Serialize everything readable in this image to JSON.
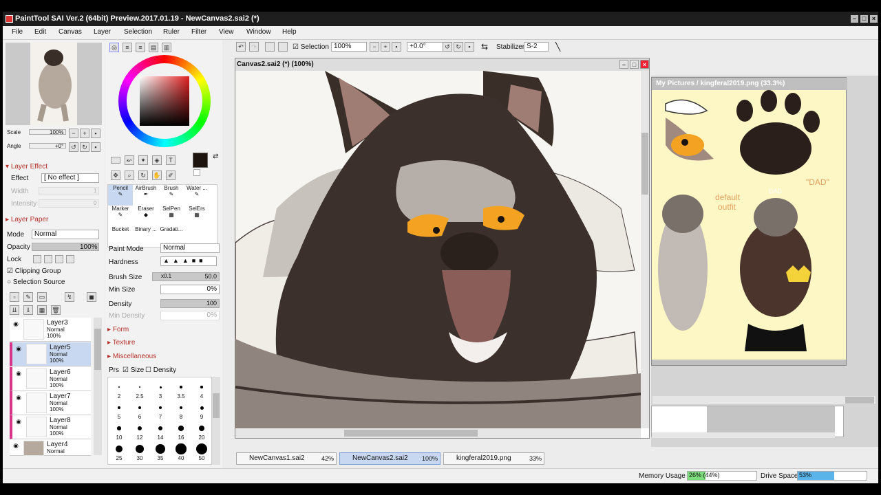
{
  "window": {
    "title": "PaintTool SAI Ver.2 (64bit) Preview.2017.01.19 - NewCanvas2.sai2 (*)"
  },
  "menu": [
    "File",
    "Edit",
    "Canvas",
    "Layer",
    "Selection",
    "Ruler",
    "Filter",
    "View",
    "Window",
    "Help"
  ],
  "navigator": {
    "scale_label": "Scale",
    "scale_value": "100%",
    "angle_label": "Angle",
    "angle_value": "+0°"
  },
  "layer_effect": {
    "header": "Layer Effect",
    "effect_label": "Effect",
    "effect_value": "[ No effect ]",
    "width_label": "Width",
    "width_value": "1",
    "intensity_label": "Intensity",
    "intensity_value": "0"
  },
  "layer_paper": {
    "header": "Layer Paper"
  },
  "layer_props": {
    "mode_label": "Mode",
    "mode_value": "Normal",
    "opacity_label": "Opacity",
    "opacity_value": "100%",
    "lock_label": "Lock",
    "clipping_label": "Clipping Group",
    "selection_source_label": "Selection Source"
  },
  "layers": [
    {
      "name": "Layer3",
      "mode": "Normal",
      "opacity": "100%"
    },
    {
      "name": "Layer5",
      "mode": "Normal",
      "opacity": "100%"
    },
    {
      "name": "Layer6",
      "mode": "Normal",
      "opacity": "100%"
    },
    {
      "name": "Layer7",
      "mode": "Normal",
      "opacity": "100%"
    },
    {
      "name": "Layer8",
      "mode": "Normal",
      "opacity": "100%"
    },
    {
      "name": "Layer4",
      "mode": "Normal",
      "opacity": ""
    }
  ],
  "tools": [
    "Pencil",
    "AirBrush",
    "Brush",
    "Water ...",
    "Marker",
    "Eraser",
    "SelPen",
    "SelErs",
    "Bucket",
    "Binary ...",
    "Gradati..."
  ],
  "brush": {
    "paint_mode_label": "Paint Mode",
    "paint_mode_value": "Normal",
    "hardness_label": "Hardness",
    "brush_size_label": "Brush Size",
    "brush_size_mult": "x0.1",
    "brush_size_value": "50.0",
    "min_size_label": "Min Size",
    "min_size_value": "0%",
    "density_label": "Density",
    "density_value": "100",
    "min_density_label": "Min Density",
    "min_density_value": "0%",
    "sections": [
      "Form",
      "Texture",
      "Miscellaneous"
    ],
    "prs_label": "Prs",
    "size_label": "Size",
    "density_check_label": "Density"
  },
  "brush_sizes": [
    "2",
    "2.5",
    "3",
    "3.5",
    "4",
    "5",
    "6",
    "7",
    "8",
    "9",
    "10",
    "12",
    "14",
    "16",
    "20",
    "25",
    "30",
    "35",
    "40",
    "50"
  ],
  "toolbar": {
    "selection_label": "Selection",
    "zoom_value": "100%",
    "rotate_value": "+0.0°",
    "stabilizer_label": "Stabilizer",
    "stabilizer_value": "S-2"
  },
  "canvas": {
    "title": "Canvas2.sai2 (*) (100%)"
  },
  "reference": {
    "title": "My Pictures / kingferal2019.png (33.3%)",
    "text1": "default",
    "text2": "outfit",
    "text3": "\"DAD\"",
    "text4": "DAD"
  },
  "tabs": [
    {
      "name": "NewCanvas1.sai2",
      "pct": "42%"
    },
    {
      "name": "NewCanvas2.sai2",
      "pct": "100%"
    },
    {
      "name": "kingferal2019.png",
      "pct": "33%"
    }
  ],
  "status": {
    "memory_label": "Memory Usage",
    "memory_value": "26% (44%)",
    "memory_fill": 0.26,
    "drive_label": "Drive Space",
    "drive_value": "53%",
    "drive_fill": 0.53
  },
  "colors": {
    "accent": "#b5302a",
    "current_color": "#1d1410",
    "selected": "#c8d8f0"
  }
}
